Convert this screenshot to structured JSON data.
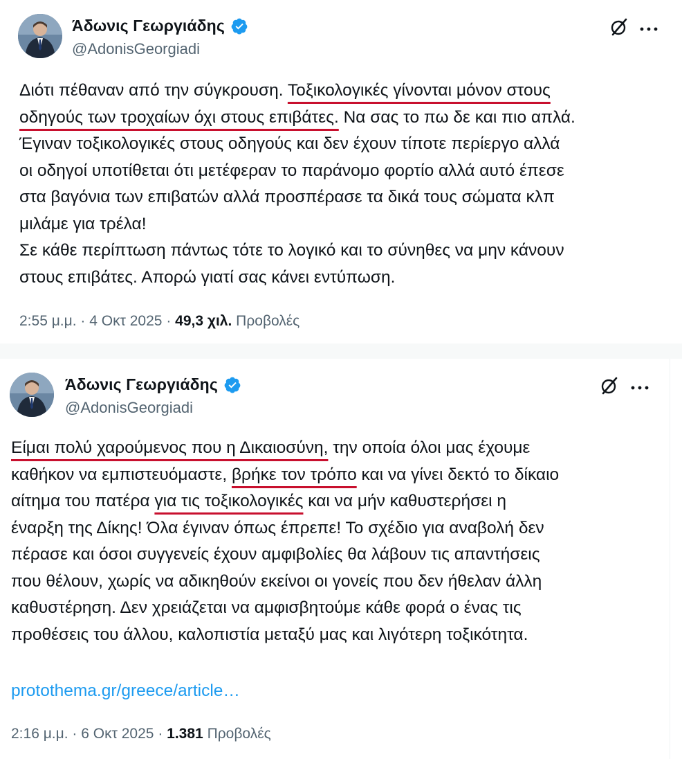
{
  "colors": {
    "link": "#1d9bf0",
    "verified": "#1d9bf0",
    "underline_highlight": "#c8102e",
    "secondary_text": "#536471"
  },
  "tweets": [
    {
      "author": {
        "display_name": "Άδωνις Γεωργιάδης",
        "handle": "@AdonisGeorgiadi",
        "verified_icon": "verified-badge-icon",
        "avatar_icon": "profile-photo"
      },
      "lines": [
        [
          {
            "text": "Διότι πέθαναν από την σύγκρουση. ",
            "hl": false
          },
          {
            "text": "Τοξικολογικές γίνονται μόνον στους",
            "hl": true
          }
        ],
        [
          {
            "text": "οδηγούς των τροχαίων όχι στους επιβάτες.",
            "hl": true
          },
          {
            "text": " Να σας το πω δε και πιο απλά.",
            "hl": false
          }
        ],
        [
          {
            "text": "Έγιναν τοξικολογικές στους οδηγούς και δεν έχουν τίποτε περίεργο αλλά",
            "hl": false
          }
        ],
        [
          {
            "text": "οι οδηγοί υποτίθεται ότι μετέφεραν το παράνομο φορτίο αλλά αυτό έπεσε",
            "hl": false
          }
        ],
        [
          {
            "text": "στα βαγόνια των επιβατών αλλά προσπέρασε τα δικά τους σώματα κλπ",
            "hl": false
          }
        ],
        [
          {
            "text": "μιλάμε για τρέλα!",
            "hl": false
          }
        ],
        [
          {
            "text": "Σε κάθε περίπτωση πάντως τότε το λογικό και το σύνηθες να μην κάνουν",
            "hl": false
          }
        ],
        [
          {
            "text": "στους επιβάτες. Απορώ γιατί σας κάνει εντύπωση.",
            "hl": false
          }
        ]
      ],
      "link": "",
      "meta": {
        "time": "2:55 μ.μ.",
        "date": "4 Οκτ 2025",
        "views_count": "49,3 χιλ.",
        "views_label": "Προβολές",
        "separator": "·"
      }
    },
    {
      "author": {
        "display_name": "Άδωνις Γεωργιάδης",
        "handle": "@AdonisGeorgiadi",
        "verified_icon": "verified-badge-icon",
        "avatar_icon": "profile-photo"
      },
      "lines": [
        [
          {
            "text": "Είμαι πολύ χαρούμενος που η Δικαιοσύνη,",
            "hl": true
          },
          {
            "text": " την οποία όλοι μας έχουμε",
            "hl": false
          }
        ],
        [
          {
            "text": "καθήκον να εμπιστευόμαστε, ",
            "hl": false
          },
          {
            "text": "βρήκε τον τρόπο",
            "hl": true
          },
          {
            "text": " και να γίνει δεκτό το δίκαιο",
            "hl": false
          }
        ],
        [
          {
            "text": "αίτημα του πατέρα ",
            "hl": false
          },
          {
            "text": "για τις τοξικολογικές",
            "hl": true
          },
          {
            "text": " και να μήν καθυστερήσει η",
            "hl": false
          }
        ],
        [
          {
            "text": "έναρξη της Δίκης! Όλα έγιναν όπως έπρεπε! Το σχέδιο για αναβολή δεν",
            "hl": false
          }
        ],
        [
          {
            "text": "πέρασε και όσοι συγγενείς έχουν αμφιβολίες θα λάβουν τις απαντήσεις",
            "hl": false
          }
        ],
        [
          {
            "text": "που θέλουν, χωρίς να αδικηθούν εκείνοι οι γονείς που δεν ήθελαν άλλη",
            "hl": false
          }
        ],
        [
          {
            "text": "καθυστέρηση. Δεν χρειάζεται να αμφισβητούμε κάθε φορά ο ένας τις",
            "hl": false
          }
        ],
        [
          {
            "text": "προθέσεις του άλλου, καλοπιστία μεταξύ μας και λιγότερη τοξικότητα.",
            "hl": false
          }
        ]
      ],
      "link": "protothema.gr/greece/article…",
      "meta": {
        "time": "2:16 μ.μ.",
        "date": "6 Οκτ 2025",
        "views_count": "1.381",
        "views_label": "Προβολές",
        "separator": "·"
      }
    }
  ]
}
